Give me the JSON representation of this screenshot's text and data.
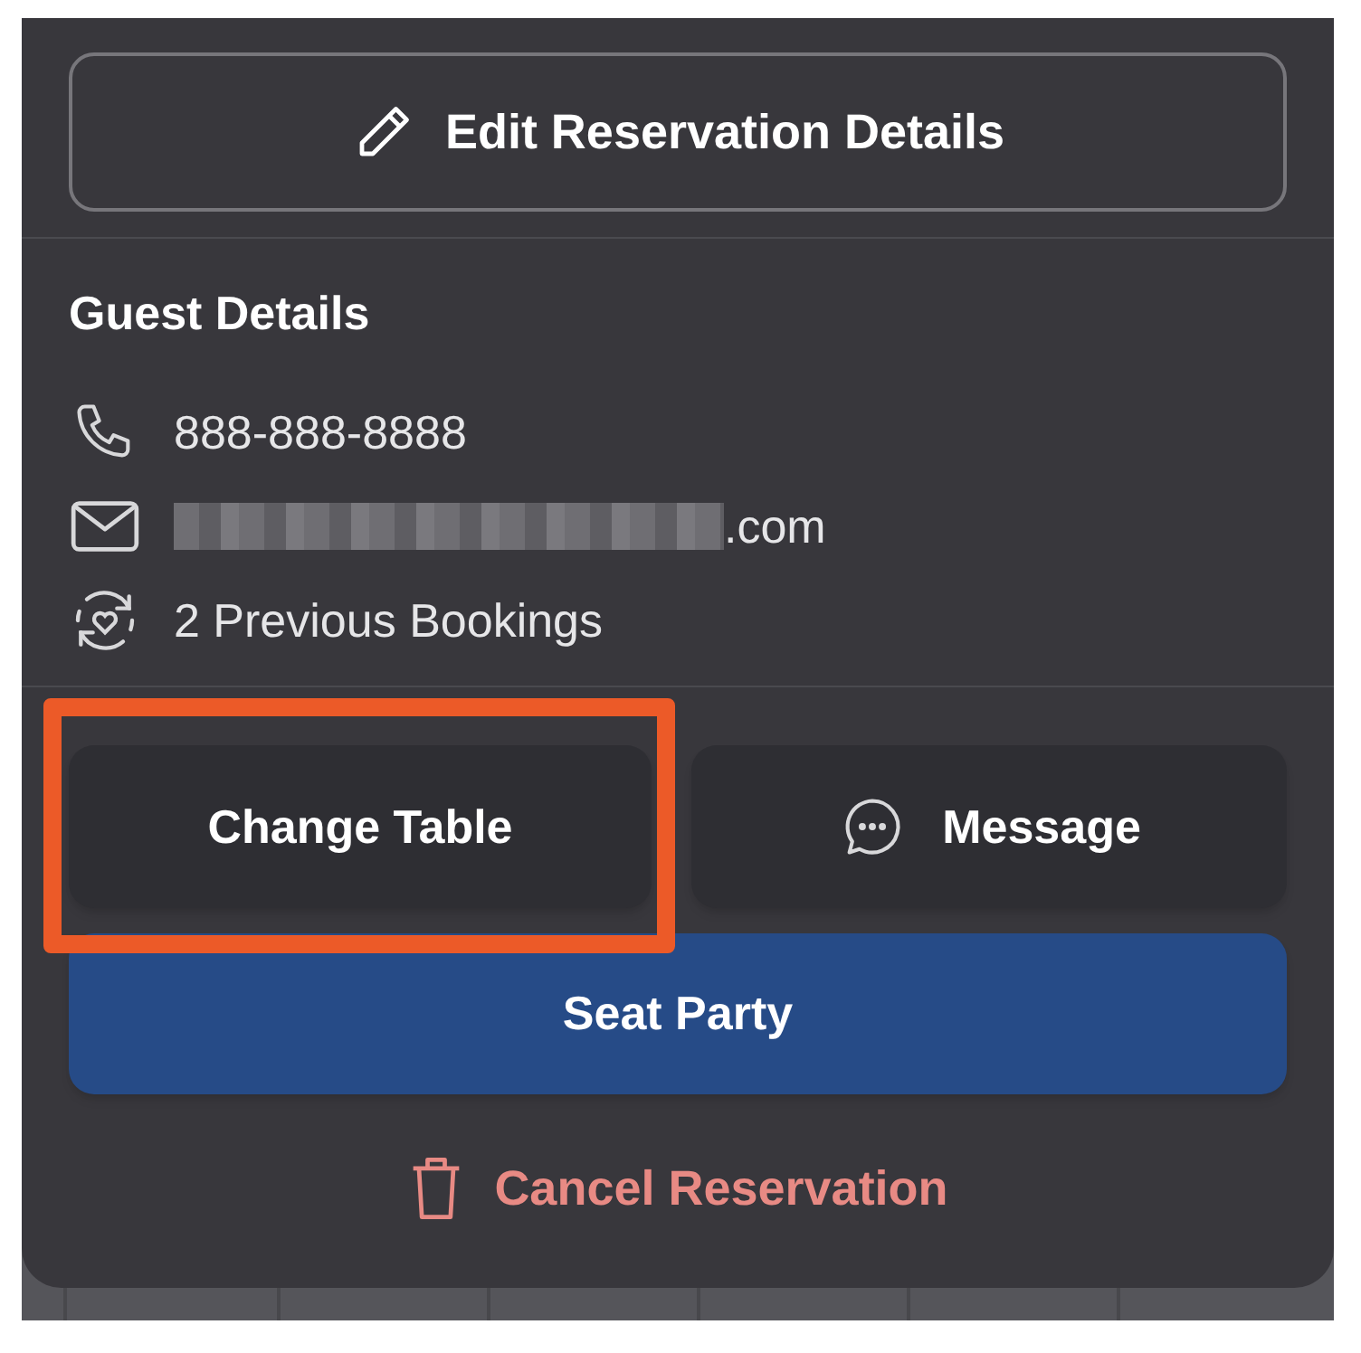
{
  "edit_button": {
    "label": "Edit Reservation Details"
  },
  "guest_details": {
    "title": "Guest Details",
    "rows": [
      {
        "kind": "phone",
        "text": "888-888-8888",
        "redacted": false
      },
      {
        "kind": "email",
        "text": ".com",
        "redacted": true
      },
      {
        "kind": "history",
        "text": "2 Previous Bookings",
        "redacted": false
      }
    ]
  },
  "action_buttons": [
    {
      "kind": "plain",
      "label": "Change Table",
      "highlighted": true
    },
    {
      "kind": "message",
      "label": "Message",
      "highlighted": false
    }
  ],
  "primary_button": {
    "label": "Seat Party"
  },
  "cancel_button": {
    "label": "Cancel Reservation"
  }
}
